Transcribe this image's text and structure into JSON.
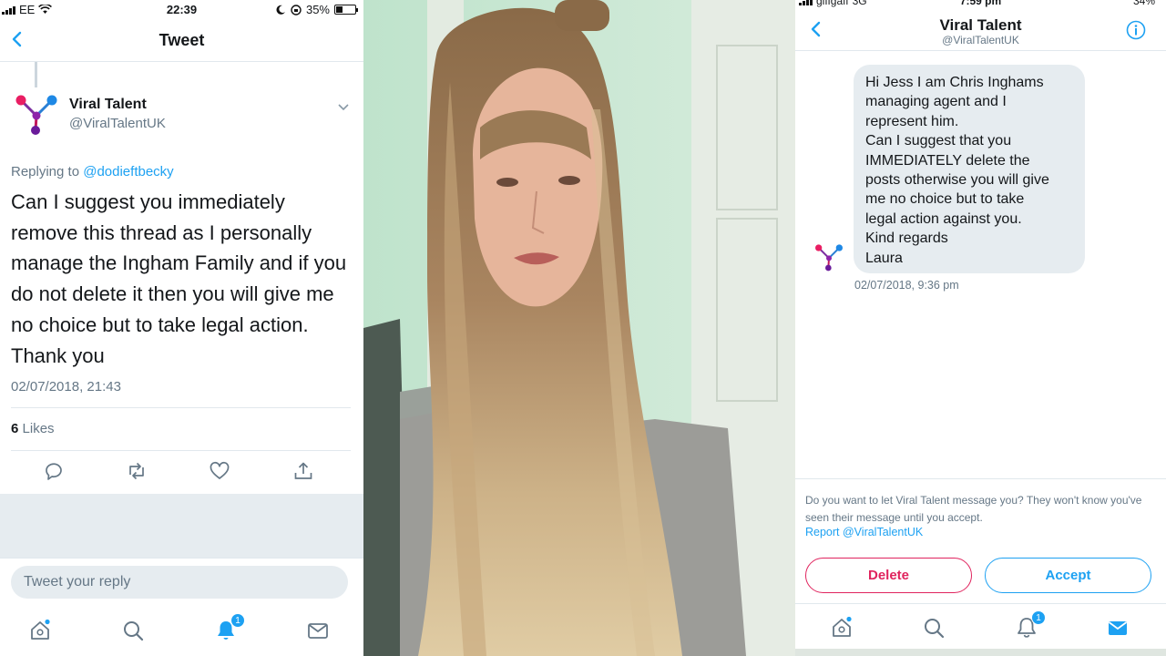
{
  "left": {
    "status": {
      "carrier": "EE",
      "time": "22:39",
      "battery": "35%",
      "battery_level": 0.35
    },
    "nav": {
      "title": "Tweet"
    },
    "author": {
      "name": "Viral Talent",
      "handle": "@ViralTalentUK"
    },
    "replying": {
      "prefix": "Replying to",
      "mention": "@dodieftbecky"
    },
    "tweet": {
      "lines": [
        "Can I suggest you immediately",
        "remove this thread as I personally",
        "manage the Ingham Family and if you",
        "do not delete it then you will give me",
        "no choice but to take legal action.",
        "Thank you"
      ],
      "time": "02/07/2018, 21:43"
    },
    "likes": {
      "count": "6",
      "label": "Likes"
    },
    "actions": [
      "reply-icon",
      "retweet-icon",
      "like-icon",
      "share-icon"
    ],
    "reply": {
      "placeholder": "Tweet your reply"
    },
    "tabbar": {
      "items": [
        "home-icon",
        "search-icon",
        "notifications-icon",
        "messages-icon"
      ],
      "notification_badge": "1"
    },
    "colors": {
      "accent": "#1da1f2",
      "text": "#14171a",
      "muted": "#657786",
      "divider": "#e1e8ed"
    }
  },
  "right": {
    "status": {
      "carrier": "giffgaff",
      "network": "3G",
      "time": "7:59 pm",
      "battery": "34%"
    },
    "nav": {
      "title": "Viral Talent",
      "handle": "@ViralTalentUK"
    },
    "message": {
      "lines": [
        "Hi Jess I am Chris Inghams",
        "managing agent and I",
        "represent him.",
        "Can I suggest that you",
        "IMMEDIATELY delete the",
        "posts otherwise you will give",
        "me no choice but to take",
        "legal action against you.",
        "Kind regards",
        "Laura"
      ],
      "time": "02/07/2018, 9:36 pm"
    },
    "request": {
      "text": "Do you want to let Viral Talent message you? They won't know you've seen their message until you accept.",
      "report": "Report @ViralTalentUK",
      "delete_label": "Delete",
      "accept_label": "Accept"
    },
    "tabbar": {
      "items": [
        "home-icon",
        "search-icon",
        "notifications-icon",
        "messages-icon"
      ],
      "notification_badge": "1"
    },
    "colors": {
      "delete": "#e0245e",
      "accept": "#1da1f2"
    }
  },
  "photo": {
    "subject": "young-woman-with-long-hair"
  }
}
